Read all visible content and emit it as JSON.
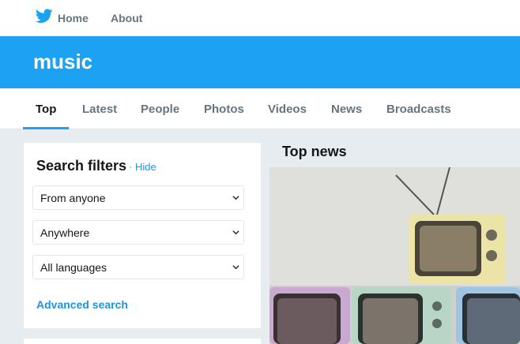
{
  "topnav": {
    "home_label": "Home",
    "about_label": "About"
  },
  "banner": {
    "title": "music"
  },
  "tabs": [
    {
      "label": "Top",
      "active": true
    },
    {
      "label": "Latest",
      "active": false
    },
    {
      "label": "People",
      "active": false
    },
    {
      "label": "Photos",
      "active": false
    },
    {
      "label": "Videos",
      "active": false
    },
    {
      "label": "News",
      "active": false
    },
    {
      "label": "Broadcasts",
      "active": false
    }
  ],
  "filters": {
    "title": "Search filters",
    "separator": "·",
    "hide_label": "Hide",
    "selects": [
      {
        "value": "From anyone"
      },
      {
        "value": "Anywhere"
      },
      {
        "value": "All languages"
      }
    ],
    "advanced_label": "Advanced search"
  },
  "news": {
    "title": "Top news"
  },
  "colors": {
    "brand": "#1da1f2",
    "link": "#1b95e0",
    "background": "#e6ecf0",
    "muted_text": "#66757f"
  },
  "icons": {
    "logo": "twitter-bird-icon",
    "select_arrow": "chevron-down-icon"
  }
}
